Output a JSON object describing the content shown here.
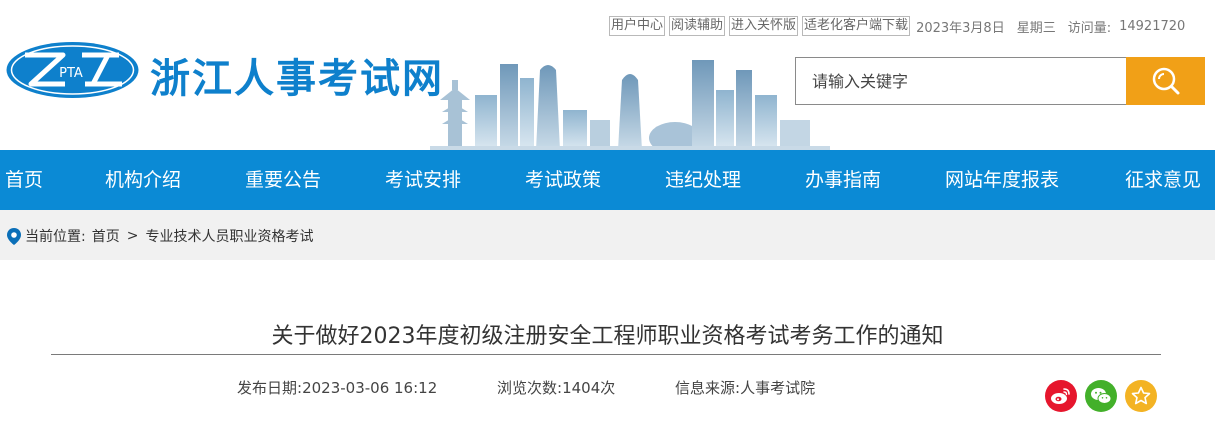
{
  "top_bar": {
    "links": [
      "用户中心",
      "阅读辅助",
      "进入关怀版",
      "适老化客户端下载"
    ],
    "date": "2023年3月8日",
    "weekday": "星期三",
    "visits_label": "访问量:",
    "visits_count": "14921720"
  },
  "logo": {
    "text": "PTA"
  },
  "site": {
    "name": "浙江人事考试网"
  },
  "search": {
    "placeholder": "请输入关键字",
    "icon": "search-icon"
  },
  "nav": [
    "首页",
    "机构介绍",
    "重要公告",
    "考试安排",
    "考试政策",
    "违纪处理",
    "办事指南",
    "网站年度报表",
    "征求意见"
  ],
  "breadcrumb": {
    "label": "当前位置:",
    "home": "首页",
    "separator": ">",
    "current": "专业技术人员职业资格考试"
  },
  "article": {
    "title": "关于做好2023年度初级注册安全工程师职业资格考试考务工作的通知",
    "publish_label": "发布日期:",
    "publish_date": "2023-03-06 16:12",
    "views_label": "浏览次数:",
    "views_value": "1404次",
    "source_label": "信息来源:",
    "source_value": "人事考试院"
  },
  "share": [
    {
      "name": "weibo-icon",
      "color": "#e6162d"
    },
    {
      "name": "wechat-icon",
      "color": "#43b02a"
    },
    {
      "name": "favorite-star-icon",
      "color": "#f3b324"
    }
  ],
  "colors": {
    "brand_blue": "#0b8ad5",
    "search_orange": "#f1a017",
    "logo_blue": "#0e80cc"
  }
}
